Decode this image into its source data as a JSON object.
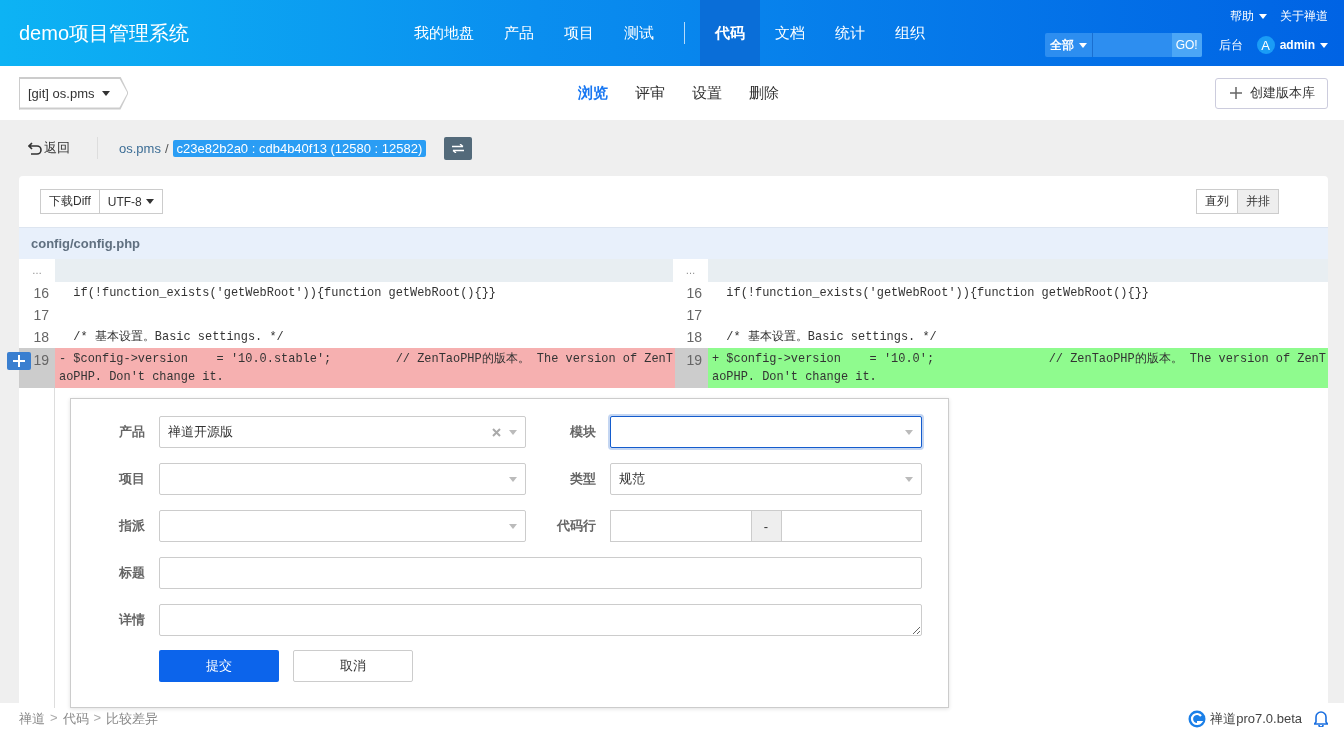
{
  "header": {
    "logo": "demo项目管理系统",
    "nav_groups": [
      [
        {
          "label": "我的地盘",
          "selected": false
        },
        {
          "label": "产品",
          "selected": false
        },
        {
          "label": "项目",
          "selected": false
        },
        {
          "label": "测试",
          "selected": false
        }
      ],
      [
        {
          "label": "代码",
          "selected": true
        },
        {
          "label": "文档",
          "selected": false
        },
        {
          "label": "统计",
          "selected": false
        },
        {
          "label": "组织",
          "selected": false
        }
      ]
    ],
    "help": "帮助",
    "about": "关于禅道",
    "search_scope": "全部",
    "search_button": "GO!",
    "admin_link": "后台",
    "avatar": "A",
    "user": "admin"
  },
  "subbar": {
    "repo": "[git] os.pms",
    "tabs": [
      {
        "label": "浏览",
        "selected": true
      },
      {
        "label": "评审",
        "selected": false
      },
      {
        "label": "设置",
        "selected": false
      },
      {
        "label": "删除",
        "selected": false
      }
    ],
    "create_button": "创建版本库"
  },
  "toolbar": {
    "back": "返回",
    "repo": "os.pms",
    "separator": "/",
    "revision": "c23e82b2a0 : cdb4b40f13 (12580 : 12582)"
  },
  "diff": {
    "download": "下载Diff",
    "encoding": "UTF-8",
    "views": [
      {
        "label": "直列",
        "selected": false
      },
      {
        "label": "并排",
        "selected": true
      }
    ],
    "file": "config/config.php",
    "rows": [
      {
        "kind": "fold",
        "left": {
          "num": "…"
        },
        "right": {
          "num": "…"
        }
      },
      {
        "kind": "context",
        "left": {
          "num": "16",
          "code": "  if(!function_exists('getWebRoot')){function getWebRoot(){}}"
        },
        "right": {
          "num": "16",
          "code": "  if(!function_exists('getWebRoot')){function getWebRoot(){}}"
        }
      },
      {
        "kind": "context",
        "left": {
          "num": "17"
        },
        "right": {
          "num": "17"
        }
      },
      {
        "kind": "context",
        "left": {
          "num": "18",
          "code": "  /* 基本设置。Basic settings. */"
        },
        "right": {
          "num": "18",
          "code": "  /* 基本设置。Basic settings. */"
        }
      },
      {
        "kind": "change",
        "left": {
          "num": "19",
          "code": "- $config->version    = '10.0.stable';         // ZenTaoPHP的版本。 The version of ZenTaoPHP. Don't change it."
        },
        "right": {
          "num": "19",
          "code": "+ $config->version    = '10.0';                // ZenTaoPHP的版本。 The version of ZenTaoPHP. Don't change it."
        }
      }
    ]
  },
  "comment_form": {
    "fields": [
      {
        "label": "产品",
        "kind": "select",
        "value": "禅道开源版",
        "clearable": true,
        "focused": false
      },
      {
        "label": "模块",
        "kind": "select",
        "focused": true
      },
      {
        "label": "项目",
        "kind": "select",
        "focused": false
      },
      {
        "label": "类型",
        "kind": "select",
        "value": "规范",
        "focused": false
      },
      {
        "label": "指派",
        "kind": "select",
        "focused": false
      },
      {
        "label": "代码行",
        "kind": "range",
        "separator": "-"
      },
      {
        "label": "标题",
        "kind": "input"
      },
      {
        "label": "详情",
        "kind": "textarea"
      }
    ],
    "submit": "提交",
    "cancel": "取消"
  },
  "footer": {
    "breadcrumb": [
      "禅道",
      "代码",
      "比较差异"
    ],
    "separator": ">",
    "version": "禅道pro7.0.beta"
  }
}
